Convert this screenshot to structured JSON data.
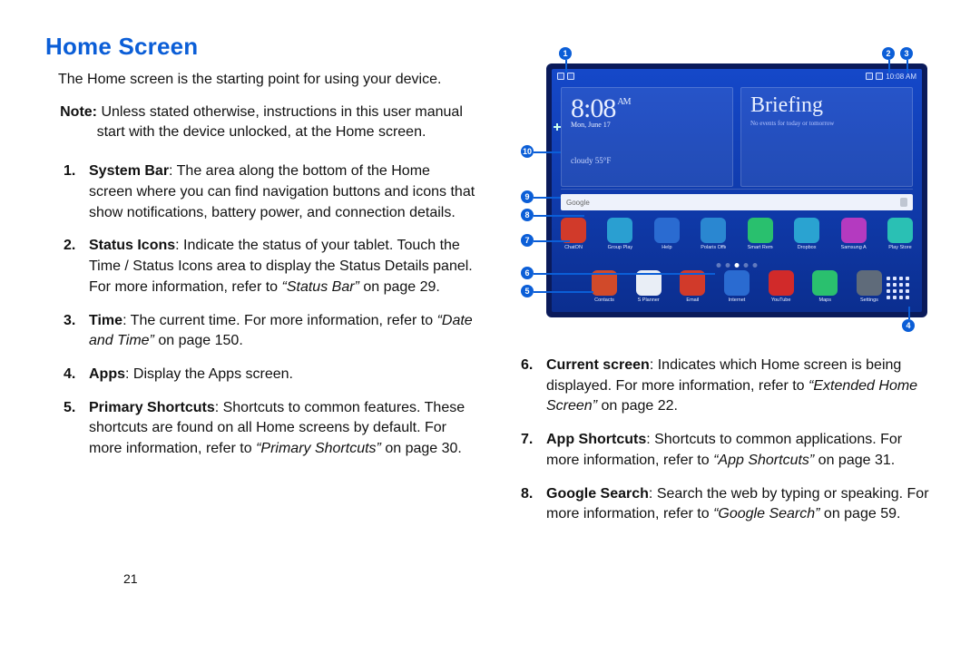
{
  "pageNumber": "21",
  "heading": "Home Screen",
  "intro": "The Home screen is the starting point for using your device.",
  "note_label": "Note:",
  "note_body": "Unless stated otherwise, instructions in this user manual start with the device unlocked, at the Home screen.",
  "items": {
    "i1": {
      "term": "System Bar",
      "body": ": The area along the bottom of the Home screen where you can find navigation buttons and icons that show notifications, battery power, and connection details."
    },
    "i2": {
      "term": "Status Icons",
      "body_a": ": Indicate the status of your tablet. Touch the Time / Status Icons area to display the Status Details panel. For more information, refer to ",
      "xref": "“Status Bar”",
      "body_b": " on page 29."
    },
    "i3": {
      "term": "Time",
      "body_a": ": The current time. For more information, refer to ",
      "xref": "“Date and Time”",
      "body_b": " on page 150."
    },
    "i4": {
      "term": "Apps",
      "body": ": Display the Apps screen."
    },
    "i5": {
      "term": "Primary Shortcuts",
      "body_a": ": Shortcuts to common features. These shortcuts are found on all Home screens by default. For more information, refer to ",
      "xref": "“Primary Shortcuts”",
      "body_b": " on page 30."
    },
    "i6": {
      "term": "Current screen",
      "body_a": ": Indicates which Home screen is being displayed. For more information, refer to ",
      "xref": "“Extended Home Screen”",
      "body_b": " on page 22."
    },
    "i7": {
      "term": "App Shortcuts",
      "body_a": ": Shortcuts to common applications. For more information, refer to ",
      "xref": "“App Shortcuts”",
      "body_b": " on page 31."
    },
    "i8": {
      "term": "Google Search",
      "body_a": ": Search the web by typing or speaking. For more information, refer to ",
      "xref": "“Google Search”",
      "body_b": " on page 59."
    }
  },
  "diagram": {
    "callouts": {
      "c1": "1",
      "c2": "2",
      "c3": "3",
      "c4": "4",
      "c5": "5",
      "c6": "6",
      "c7": "7",
      "c8": "8",
      "c9": "9",
      "c10": "10"
    },
    "status_time": "10:08 AM",
    "clock": {
      "time": "8:08",
      "ampm": "AM",
      "date": "Mon, June 17",
      "weather": "cloudy 55°F"
    },
    "briefing": {
      "title": "Briefing",
      "sub": "No events for today or tomorrow"
    },
    "search_placeholder": "Google",
    "row7": [
      {
        "name": "ChatON",
        "color": "#d13a2a"
      },
      {
        "name": "Group Play",
        "color": "#2a9fd1"
      },
      {
        "name": "Help",
        "color": "#2a6bd1"
      },
      {
        "name": "Polaris Office",
        "color": "#2a87d1"
      },
      {
        "name": "Smart Remote",
        "color": "#29c06e"
      },
      {
        "name": "Dropbox",
        "color": "#2aa3d1"
      },
      {
        "name": "Samsung Apps",
        "color": "#b43ac0"
      },
      {
        "name": "Play Store",
        "color": "#2ac0b4"
      }
    ],
    "row5": [
      {
        "name": "Contacts",
        "color": "#d14a2a"
      },
      {
        "name": "S Planner",
        "color": "#e9eef6"
      },
      {
        "name": "Email",
        "color": "#d13a2a"
      },
      {
        "name": "Internet",
        "color": "#2a6bd1"
      },
      {
        "name": "YouTube",
        "color": "#d12a2a"
      },
      {
        "name": "Maps",
        "color": "#2ac06e"
      },
      {
        "name": "Settings",
        "color": "#5f6b7a"
      }
    ]
  }
}
